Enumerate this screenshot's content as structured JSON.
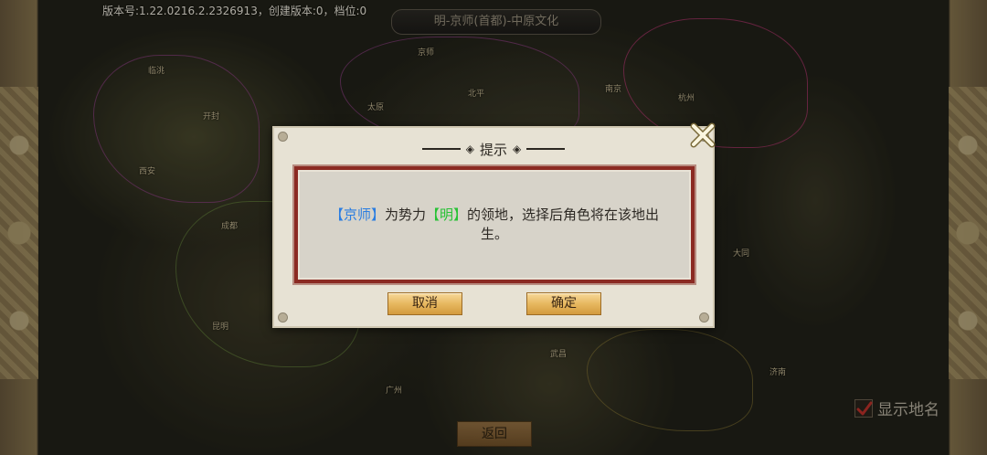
{
  "version_text": "版本号:1.22.0216.2.2326913，创建版本:0，档位:0",
  "map_title": "明-京师(首都)-中原文化",
  "place_names": [
    "京师",
    "临洮",
    "北平",
    "太原",
    "开封",
    "西安",
    "成都",
    "昆明",
    "广州",
    "杭州",
    "南京",
    "武昌",
    "大同",
    "济南"
  ],
  "dialog": {
    "title": "提示",
    "message": {
      "bracket_open": "【",
      "bracket_close": "】",
      "location": "京师",
      "part1": "为势力",
      "faction": "明",
      "part2": "的领地，选择后角色将在该地出生。"
    },
    "cancel_label": "取消",
    "confirm_label": "确定"
  },
  "back_label": "返回",
  "show_names": {
    "label": "显示地名",
    "checked": true
  },
  "colors": {
    "highlight_location": "#2a7de1",
    "highlight_faction": "#27c235",
    "dialog_border": "#8b2a22",
    "button_gold": "#e7b860"
  },
  "icons": {
    "close": "close-icon",
    "check": "checkmark-icon",
    "title_ornament": "diamond-ornament-icon"
  }
}
